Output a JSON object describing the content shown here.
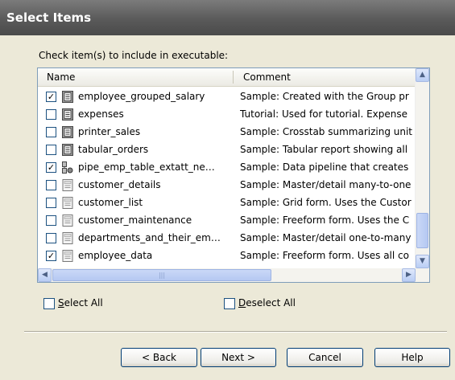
{
  "window": {
    "title": "Select Items"
  },
  "instruction": "Check item(s) to include in executable:",
  "columns": {
    "name": "Name",
    "comment": "Comment"
  },
  "items": [
    {
      "name": "employee_grouped_salary",
      "comment": "Sample: Created with the Group pr",
      "checked": true,
      "icon": "report-icon"
    },
    {
      "name": "expenses",
      "comment": "Tutorial: Used for tutorial. Expense",
      "checked": false,
      "icon": "report-icon"
    },
    {
      "name": "printer_sales",
      "comment": "Sample: Crosstab summarizing unit",
      "checked": false,
      "icon": "report-icon"
    },
    {
      "name": "tabular_orders",
      "comment": "Sample: Tabular report showing all",
      "checked": false,
      "icon": "report-icon"
    },
    {
      "name": "pipe_emp_table_extatt_ne…",
      "comment": "Sample: Data pipeline that creates",
      "checked": true,
      "icon": "pipeline-icon"
    },
    {
      "name": "customer_details",
      "comment": "Sample: Master/detail many-to-one",
      "checked": false,
      "icon": "form-icon"
    },
    {
      "name": "customer_list",
      "comment": "Sample: Grid form. Uses the Custor",
      "checked": false,
      "icon": "form-icon"
    },
    {
      "name": "customer_maintenance",
      "comment": "Sample: Freeform form. Uses the C",
      "checked": false,
      "icon": "form-icon"
    },
    {
      "name": "departments_and_their_em…",
      "comment": "Sample: Master/detail one-to-many",
      "checked": false,
      "icon": "form-icon"
    },
    {
      "name": "employee_data",
      "comment": "Sample: Freeform form. Uses all co",
      "checked": true,
      "icon": "form-icon"
    }
  ],
  "select_all": {
    "accel": "S",
    "rest": "elect All"
  },
  "deselect_all": {
    "accel": "D",
    "rest": "eselect All"
  },
  "buttons": {
    "back": "< Back",
    "next": "Next >",
    "cancel": "Cancel",
    "help": "Help"
  },
  "colors": {
    "header_bg": "#5a5a5a",
    "panel_bg": "#ece9d8",
    "list_border": "#7f9db9",
    "button_border": "#003c74"
  }
}
